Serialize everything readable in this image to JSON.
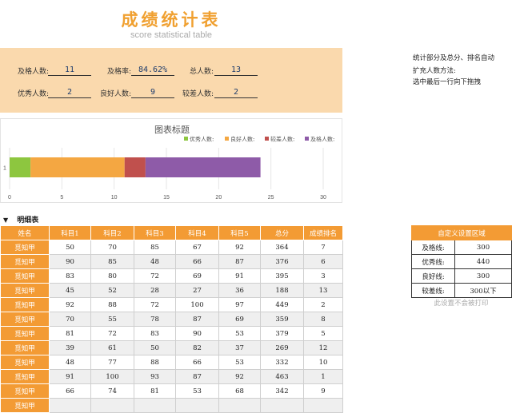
{
  "header": {
    "title": "成绩统计表",
    "subtitle": "score statistical table"
  },
  "summary": {
    "pass_count": {
      "label": "及格人数:",
      "value": "11"
    },
    "pass_rate": {
      "label": "及格率:",
      "value": "84.62%"
    },
    "total": {
      "label": "总人数:",
      "value": "13"
    },
    "excellent": {
      "label": "优秀人数:",
      "value": "2"
    },
    "good": {
      "label": "良好人数:",
      "value": "9"
    },
    "poor": {
      "label": "较差人数:",
      "value": "2"
    }
  },
  "notes": {
    "line1": "统计部分及总分、排名自动",
    "line2": "扩充人数方法:",
    "line3": "选中最后一行向下拖拽"
  },
  "chart_data": {
    "type": "bar",
    "orientation": "horizontal",
    "stacked": true,
    "title": "图表标题",
    "categories": [
      "1"
    ],
    "series": [
      {
        "name": "优秀人数:",
        "values": [
          2
        ],
        "color": "#8dc63f"
      },
      {
        "name": "良好人数:",
        "values": [
          9
        ],
        "color": "#f4a742"
      },
      {
        "name": "较差人数:",
        "values": [
          2
        ],
        "color": "#c0504d"
      },
      {
        "name": "及格人数:",
        "values": [
          11
        ],
        "color": "#8e5ba8"
      }
    ],
    "xlim": [
      0,
      30
    ],
    "xticks": [
      "0",
      "5",
      "10",
      "15",
      "20",
      "25",
      "30"
    ],
    "legend": "top-right",
    "grid": true
  },
  "detail": {
    "heading": "明细表",
    "columns": [
      "姓名",
      "科目1",
      "科目2",
      "科目3",
      "科目4",
      "科目5",
      "总分",
      "成绩排名"
    ],
    "rows": [
      [
        "觅知甲",
        "50",
        "70",
        "85",
        "67",
        "92",
        "364",
        "7"
      ],
      [
        "觅知甲",
        "90",
        "85",
        "48",
        "66",
        "87",
        "376",
        "6"
      ],
      [
        "觅知甲",
        "83",
        "80",
        "72",
        "69",
        "91",
        "395",
        "3"
      ],
      [
        "觅知甲",
        "45",
        "52",
        "28",
        "27",
        "36",
        "188",
        "13"
      ],
      [
        "觅知甲",
        "92",
        "88",
        "72",
        "100",
        "97",
        "449",
        "2"
      ],
      [
        "觅知甲",
        "70",
        "55",
        "78",
        "87",
        "69",
        "359",
        "8"
      ],
      [
        "觅知甲",
        "81",
        "72",
        "83",
        "90",
        "53",
        "379",
        "5"
      ],
      [
        "觅知甲",
        "39",
        "61",
        "50",
        "82",
        "37",
        "269",
        "12"
      ],
      [
        "觅知甲",
        "48",
        "77",
        "88",
        "66",
        "53",
        "332",
        "10"
      ],
      [
        "觅知甲",
        "91",
        "100",
        "93",
        "87",
        "92",
        "463",
        "1"
      ],
      [
        "觅知甲",
        "66",
        "74",
        "81",
        "53",
        "68",
        "342",
        "9"
      ],
      [
        "觅知甲",
        "",
        "",
        "",
        "",
        "",
        "",
        ""
      ]
    ]
  },
  "settings": {
    "header": "自定义设置区域",
    "rows": [
      {
        "label": "及格线:",
        "value": "300"
      },
      {
        "label": "优秀线:",
        "value": "440"
      },
      {
        "label": "良好线:",
        "value": "300"
      },
      {
        "label": "较差线:",
        "value": "300以下"
      }
    ],
    "note": "此设置不会被打印"
  }
}
